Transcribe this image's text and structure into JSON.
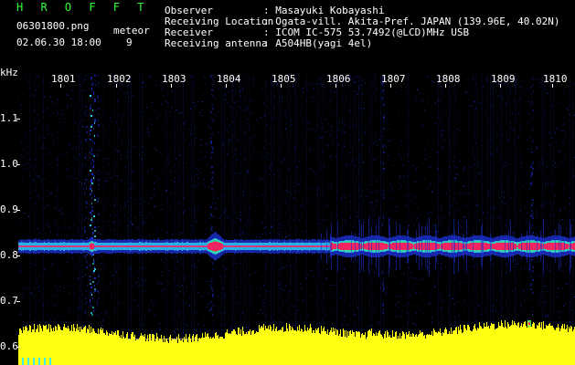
{
  "header": {
    "app_title": "H R O F F T",
    "file_name": "06301800.png",
    "datetime": "02.06.30 18:00",
    "meteor_label": "meteor",
    "meteor_count": "9"
  },
  "info": [
    {
      "label": "Observer",
      "value": ": Masayuki Kobayashi"
    },
    {
      "label": "Receiving Location",
      "value": ": Ogata-vill. Akita-Pref. JAPAN (139.96E, 40.02N)"
    },
    {
      "label": "Receiver",
      "value": ": ICOM IC-575 53.7492(@LCD)MHz USB"
    },
    {
      "label": "Receiving antenna",
      "value": ": A504HB(yagi 4el)"
    }
  ],
  "axis": {
    "unit": "kHz",
    "y_ticks": [
      "1.1",
      "1.0",
      "0.9",
      "0.8",
      "0.7",
      "0.6"
    ],
    "x_ticks": [
      "1801",
      "1802",
      "1803",
      "1804",
      "1805",
      "1806",
      "1807",
      "1808",
      "1809",
      "1810"
    ]
  },
  "colors": {
    "background": "#000000",
    "text_green": "#33ff33",
    "noise_blue": "#1a2fd0",
    "signal_cyan": "#30e8ff",
    "signal_green": "#40ff60",
    "signal_red": "#ff1a60",
    "signal_yellow": "#ffff10",
    "baseline_line": "#9090c0"
  }
}
